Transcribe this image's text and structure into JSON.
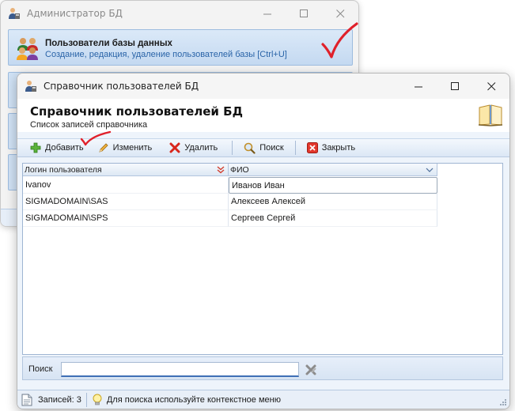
{
  "back_window": {
    "title": "Администратор БД",
    "item": {
      "title": "Пользователи базы данных",
      "subtitle": "Создание, редакция, удаление пользователей базы [Ctrl+U]"
    }
  },
  "front_window": {
    "title": "Справочник пользователей БД",
    "header": {
      "title": "Справочник пользователей БД",
      "subtitle": "Список записей справочника"
    },
    "toolbar": {
      "add": "Добавить",
      "edit": "Изменить",
      "delete": "Удалить",
      "search": "Поиск",
      "close": "Закрыть"
    },
    "grid": {
      "columns": [
        "Логин пользователя",
        "ФИО"
      ],
      "rows": [
        {
          "login": "Ivanov",
          "fio": "Иванов Иван"
        },
        {
          "login": "SIGMADOMAIN\\SAS",
          "fio": "Алексеев Алексей"
        },
        {
          "login": "SIGMADOMAIN\\SPS",
          "fio": "Сергеев Сергей"
        }
      ]
    },
    "search": {
      "label": "Поиск",
      "value": ""
    },
    "status": {
      "records": "Записей: 3",
      "hint": "Для поиска используйте контекстное меню"
    }
  },
  "colors": {
    "accent": "#3f6fb5",
    "annotation": "#e0202a"
  }
}
